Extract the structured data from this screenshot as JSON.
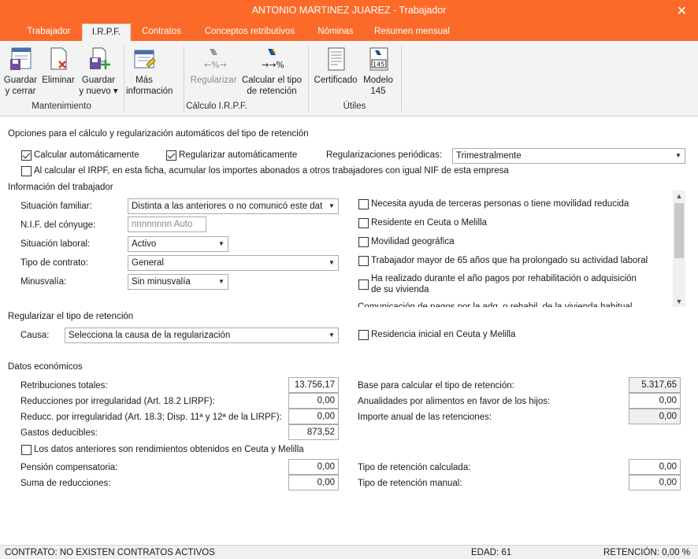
{
  "window": {
    "title": "ANTONIO MARTINEZ JUAREZ - Trabajador",
    "close_glyph": "✕"
  },
  "tabs": [
    "Trabajador",
    "I.R.P.F.",
    "Contratos",
    "Conceptos retributivos",
    "Nóminas",
    "Resumen mensual"
  ],
  "active_tab": "I.R.P.F.",
  "ribbon": {
    "buttons": {
      "guardar_cerrar": [
        "Guardar",
        "y cerrar"
      ],
      "eliminar": [
        "Eliminar",
        ""
      ],
      "guardar_nuevo": [
        "Guardar",
        "y nuevo ▾"
      ],
      "mas_informacion": [
        "Más",
        "información"
      ],
      "regularizar": [
        "Regularizar",
        ""
      ],
      "calcular_tipo": [
        "Calcular el tipo",
        "de retención"
      ],
      "certificado": [
        "Certificado",
        ""
      ],
      "modelo145": [
        "Modelo",
        "145"
      ]
    },
    "groups": {
      "mantenimiento": "Mantenimiento",
      "calculo": "Cálculo I.R.P.F.",
      "utiles": "Útiles"
    },
    "icons": [
      "save-close-icon",
      "delete-icon",
      "save-new-icon",
      "info-icon",
      "regularize-icon",
      "calculate-icon",
      "certificate-icon",
      "model145-icon"
    ]
  },
  "options": {
    "heading": "Opciones para el cálculo y regularización automáticos del tipo de retención",
    "calc_auto": {
      "label": "Calcular automáticamente",
      "checked": true
    },
    "reg_auto": {
      "label": "Regularizar automáticamente",
      "checked": true
    },
    "reg_periodicas_label": "Regularizaciones periódicas:",
    "reg_periodicas_value": "Trimestralmente",
    "acumular": {
      "label": "Al calcular el IRPF, en esta ficha, acumular los importes abonados a otros trabajadores con igual NIF de esta empresa",
      "checked": false
    }
  },
  "worker": {
    "heading": "Información del trabajador",
    "situacion_familiar": {
      "label": "Situación familiar:",
      "value": "Distinta a las anteriores o no comunicó este dat"
    },
    "nif_conyuge": {
      "label": "N.I.F. del cónyuge:",
      "placeholder": "nnnnnnnn Auto"
    },
    "situacion_laboral": {
      "label": "Situación laboral:",
      "value": "Activo"
    },
    "tipo_contrato": {
      "label": "Tipo de contrato:",
      "value": "General"
    },
    "minusvalia": {
      "label": "Minusvalía:",
      "value": "Sin minusvalía"
    },
    "checks": [
      "Necesita ayuda de terceras personas o tiene movilidad reducida",
      "Residente en Ceuta o Melilla",
      "Movilidad geográfica",
      "Trabajador mayor de 65 años que ha prolongado su actividad laboral",
      "Ha realizado durante el año pagos por rehabilitación o adquisición",
      "de su vivienda"
    ],
    "cut_text": "Comunicación de pagos por la adq. o rehabil. de la vivienda habitual"
  },
  "regularizar": {
    "heading": "Regularizar el tipo de retención",
    "causa_label": "Causa:",
    "causa_value": "Selecciona la causa de la regularización",
    "residencia_inicial": "Residencia inicial en Ceuta y Melilla"
  },
  "economic": {
    "heading": "Datos económicos",
    "left": [
      {
        "label": "Retribuciones totales:",
        "value": "13.756,17"
      },
      {
        "label": "Reducciones por irregularidad (Art. 18.2 LIRPF):",
        "value": "0,00"
      },
      {
        "label": "Reducc. por irregularidad (Art. 18.3; Disp. 11ª y 12ª de la LIRPF):",
        "value": "0,00"
      },
      {
        "label": "Gastos deducibles:",
        "value": "873,52"
      }
    ],
    "right": [
      {
        "label": "Base para calcular el tipo de retención:",
        "value": "5.317,65"
      },
      {
        "label": "Anualidades por alimentos en favor de los hijos:",
        "value": "0,00"
      },
      {
        "label": "Importe anual de las retenciones:",
        "value": "0,00"
      }
    ],
    "ceuta_check": "Los datos anteriores son rendimientos obtenidos en Ceuta y Melilla",
    "pension": {
      "label": "Pensión compensatoria:",
      "value": "0,00"
    },
    "suma": {
      "label": "Suma de reducciones:",
      "value": "0,00"
    },
    "tipo_calculada": {
      "label": "Tipo de retención calculada:",
      "value": "0,00"
    },
    "tipo_manual": {
      "label": "Tipo de retención manual:",
      "value": "0,00"
    }
  },
  "status": {
    "contrato": "CONTRATO: NO EXISTEN CONTRATOS ACTIVOS",
    "edad": "EDAD: 61",
    "retencion": "RETENCIÓN: 0,00 %"
  },
  "colors": {
    "accent": "#fb6a28",
    "ribbon_bg": "#f3f3f3"
  }
}
